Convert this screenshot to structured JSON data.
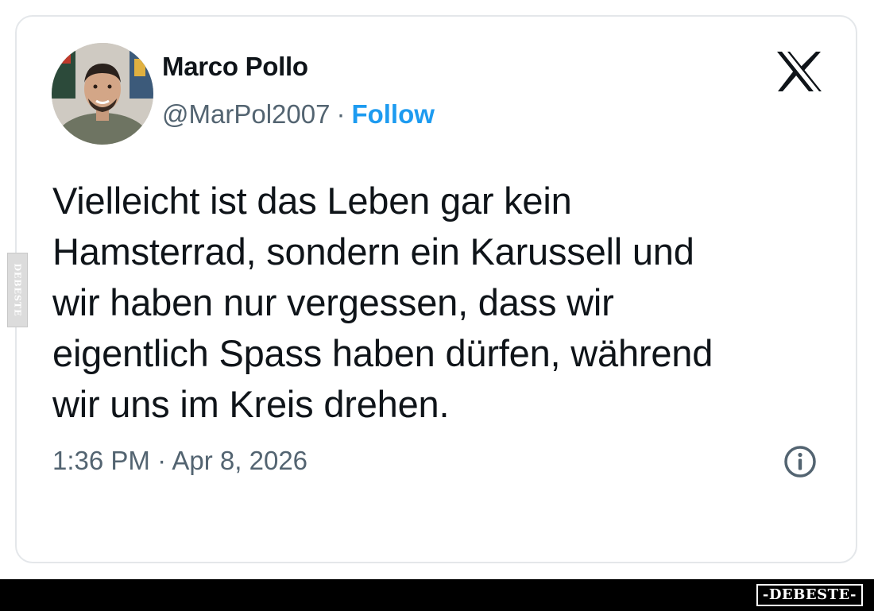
{
  "tweet": {
    "author_name": "Marco Pollo",
    "handle": "@MarPol2007",
    "separator": "·",
    "follow_label": "Follow",
    "text_lines": [
      "Vielleicht ist das Leben gar kein",
      "Hamsterrad, sondern ein Karussell und",
      "wir haben nur vergessen, dass wir",
      "eigentlich Spass haben dürfen, während",
      "wir uns im Kreis drehen."
    ],
    "timestamp": "1:36 PM · Apr 8, 2026"
  },
  "icons": {
    "platform_logo": "x-logo-icon",
    "info": "info-icon",
    "avatar": "avatar"
  },
  "watermark": {
    "side_label": "DEBESTE",
    "footer_label": "-DEBESTE-"
  },
  "colors": {
    "text_primary": "#0f1419",
    "text_secondary": "#536471",
    "follow_blue": "#1d9bf0",
    "card_border": "#e4e7ea",
    "footer_bg": "#000000"
  }
}
